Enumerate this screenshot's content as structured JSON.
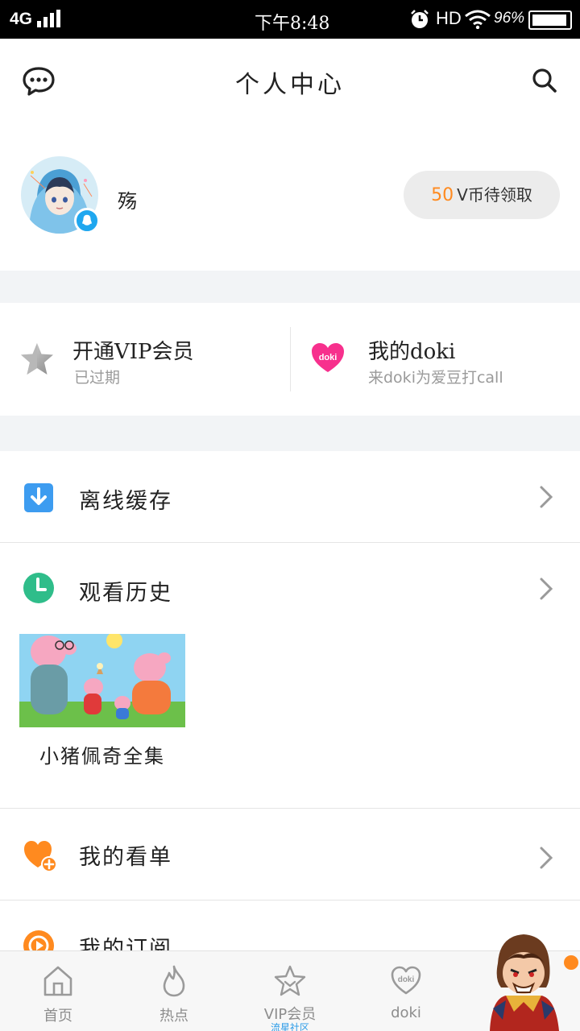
{
  "status_bar": {
    "network": "4G",
    "time": "下午8:48",
    "hd": "HD",
    "battery": "96%",
    "battery_level": 0.96
  },
  "header": {
    "title": "个人中心",
    "message_icon": "chat-bubble-icon",
    "search_icon": "search-icon"
  },
  "profile": {
    "username": "殇",
    "coin_amount": "50",
    "coin_text": "V币待领取",
    "badge_icon": "qq-penguin-icon"
  },
  "cards": {
    "vip": {
      "title": "开通VIP会员",
      "subtitle": "已过期",
      "icon": "star-icon"
    },
    "doki": {
      "title": "我的doki",
      "subtitle": "来doki为爱豆打call",
      "icon": "doki-heart-icon"
    }
  },
  "menu": {
    "offline": {
      "label": "离线缓存",
      "icon": "download-icon"
    },
    "history": {
      "label": "观看历史",
      "icon": "clock-icon"
    },
    "watchlist": {
      "label": "我的看单",
      "icon": "heart-plus-icon"
    },
    "subscribe": {
      "label": "我的订阅",
      "icon": "play-circle-icon"
    }
  },
  "history_items": [
    {
      "title": "小猪佩奇全集"
    }
  ],
  "bottom_nav": {
    "items": [
      {
        "label": "首页",
        "icon": "home-icon"
      },
      {
        "label": "热点",
        "icon": "flame-icon"
      },
      {
        "label": "VIP会员",
        "sublabel": "流星社区",
        "icon": "vip-star-icon"
      },
      {
        "label": "doki",
        "icon": "doki-heart-icon"
      }
    ]
  },
  "colors": {
    "accent_orange": "#ff8a1f",
    "accent_blue": "#2e9cf3",
    "accent_green": "#2fbd8a",
    "background_gray": "#f2f4f6"
  }
}
